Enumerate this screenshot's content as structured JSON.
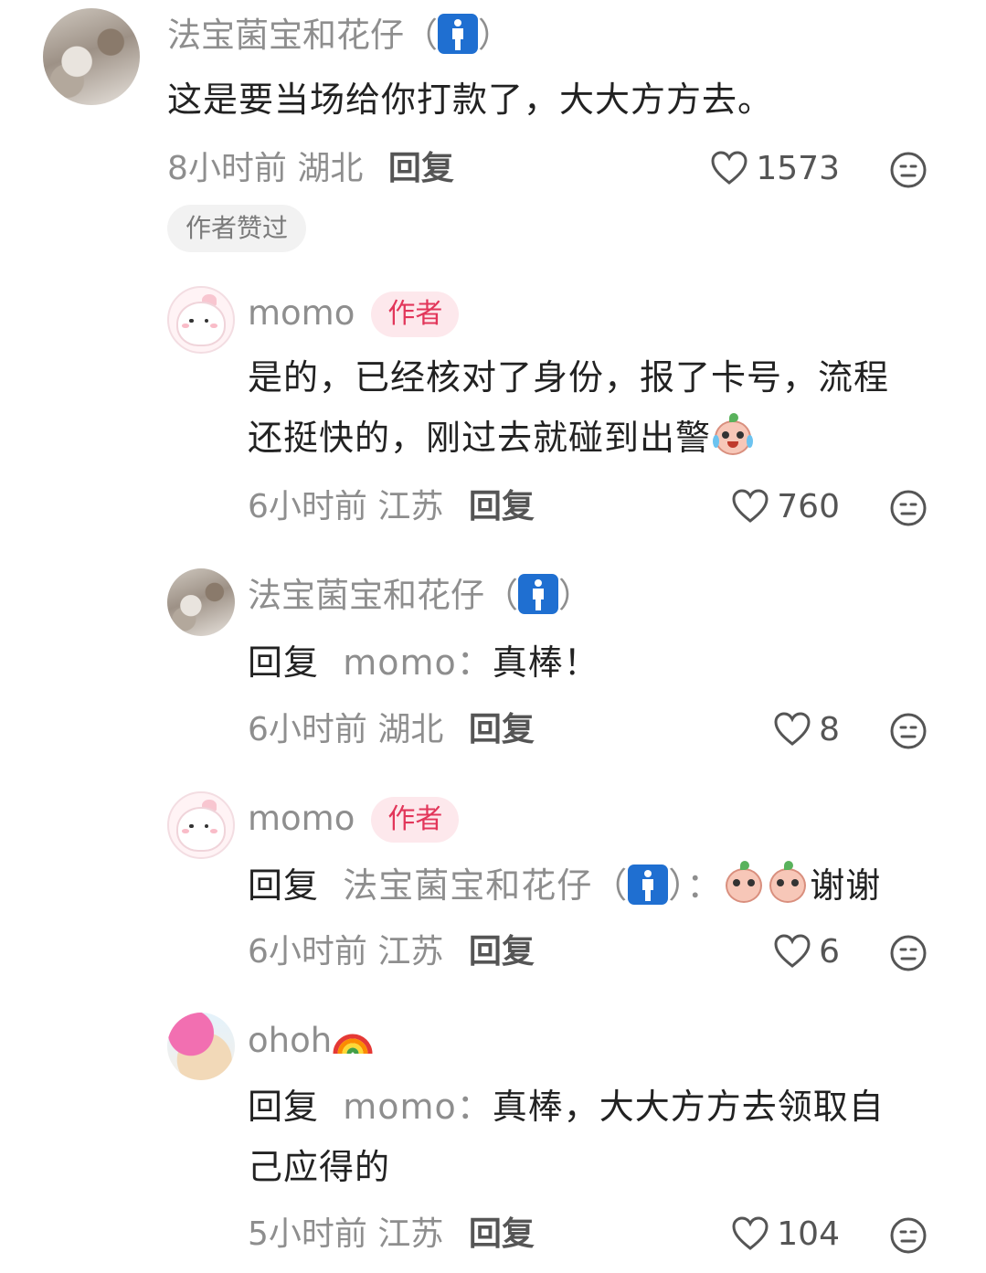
{
  "comments": [
    {
      "name": "法宝菌宝和花仔（",
      "name_suffix": "）",
      "text": "这是要当场给你打款了，大大方方去。",
      "time": "8小时前",
      "location": "湖北",
      "reply_label": "回复",
      "likes": "1573",
      "liked_chip": "作者赞过"
    },
    {
      "name": "momo",
      "author_tag": "作者",
      "text_line1": "是的，已经核对了身份，报了卡号，流程",
      "text_line2": "还挺快的，刚过去就碰到出警",
      "time": "6小时前",
      "location": "江苏",
      "reply_label": "回复",
      "likes": "760"
    },
    {
      "name": "法宝菌宝和花仔（",
      "name_suffix": "）",
      "reply_prefix": "回复",
      "reply_to": "momo：",
      "text": "真棒！",
      "time": "6小时前",
      "location": "湖北",
      "reply_label": "回复",
      "likes": "8"
    },
    {
      "name": "momo",
      "author_tag": "作者",
      "reply_prefix": "回复",
      "reply_to": "法宝菌宝和花仔（",
      "reply_to_suffix": "）：",
      "text": "谢谢",
      "time": "6小时前",
      "location": "江苏",
      "reply_label": "回复",
      "likes": "6"
    },
    {
      "name": "ohoh",
      "reply_prefix": "回复",
      "reply_to": "momo：",
      "text_line1": "真棒，大大方方去领取自",
      "text_line2": "己应得的",
      "time": "5小时前",
      "location": "江苏",
      "reply_label": "回复",
      "likes": "104"
    }
  ],
  "icons": {
    "like": "heart-outline-icon",
    "dislike": "neutral-face-icon",
    "badge": "mens-room-icon",
    "rainbow": "rainbow-icon"
  },
  "colors": {
    "author_tag_bg": "#fde8ec",
    "author_tag_text": "#e2365a",
    "badge_blue": "#1f6fd1"
  }
}
